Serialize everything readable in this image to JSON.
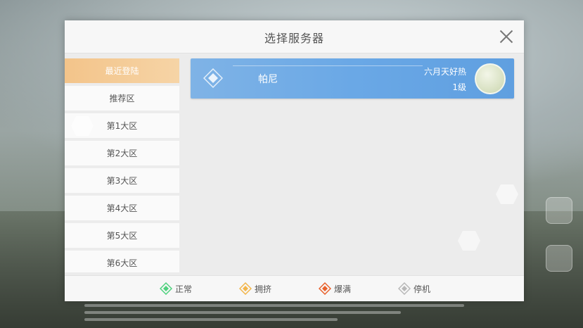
{
  "modal": {
    "title": "选择服务器"
  },
  "sidebar": {
    "items": [
      {
        "label": "最近登陆",
        "active": true
      },
      {
        "label": "推荐区",
        "active": false
      },
      {
        "label": "第1大区",
        "active": false
      },
      {
        "label": "第2大区",
        "active": false
      },
      {
        "label": "第3大区",
        "active": false
      },
      {
        "label": "第4大区",
        "active": false
      },
      {
        "label": "第5大区",
        "active": false
      },
      {
        "label": "第6大区",
        "active": false
      }
    ]
  },
  "server_card": {
    "server_name": "帕尼",
    "player_name": "六月天好热",
    "player_level": "1级"
  },
  "legend": [
    {
      "label": "正常",
      "color": "#4fd17e"
    },
    {
      "label": "拥挤",
      "color": "#f2b54a"
    },
    {
      "label": "爆满",
      "color": "#e8612c"
    },
    {
      "label": "停机",
      "color": "#b8b8b8"
    }
  ],
  "colors": {
    "accent": "#f3c48a",
    "card": "#6aa8e6"
  },
  "icons": {
    "close": "close-icon",
    "server": "diamond-icon",
    "avatar": "player-avatar"
  }
}
